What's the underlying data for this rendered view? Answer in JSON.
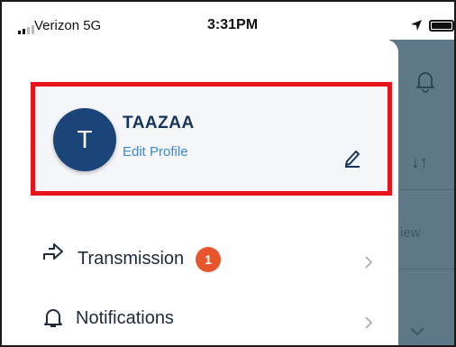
{
  "status_bar": {
    "carrier": "Verizon  5G",
    "time": "3:31PM"
  },
  "profile": {
    "avatar_initial": "T",
    "name": "TAAZAA",
    "edit_label": "Edit Profile"
  },
  "menu": [
    {
      "label": "Transmission",
      "badge": "1",
      "icon": "share-arrow-icon"
    },
    {
      "label": "Notifications",
      "icon": "bell-icon"
    }
  ],
  "background_app": {
    "sort_glyph": "↓↑",
    "partial_text": "iew"
  },
  "colors": {
    "highlight_border": "#e8141c",
    "avatar": "#1b4478",
    "name_text": "#16355b",
    "edit_link": "#3b8ad6",
    "badge": "#e8552d",
    "background_app": "#5f7888"
  }
}
